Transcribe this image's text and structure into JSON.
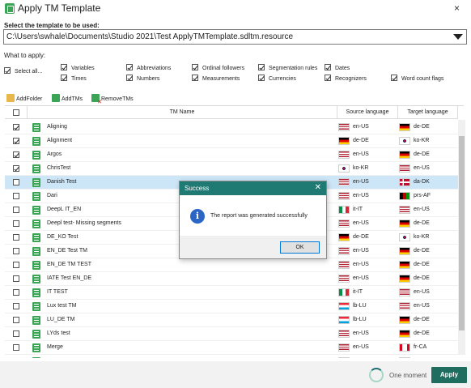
{
  "window": {
    "title": "Apply TM Template",
    "close_glyph": "×"
  },
  "template": {
    "label": "Select the template to be used:",
    "value": "C:\\Users\\swhale\\Documents\\Studio 2021\\Test ApplyTMTemplate.sdltm.resource"
  },
  "apply": {
    "label": "What to apply:",
    "options": [
      {
        "label": "Select all...",
        "checked": true
      },
      {
        "label": "Variables",
        "checked": true
      },
      {
        "label": "Times",
        "checked": true
      },
      {
        "label": "Abbreviations",
        "checked": true
      },
      {
        "label": "Numbers",
        "checked": true
      },
      {
        "label": "Ordinal followers",
        "checked": true
      },
      {
        "label": "Measurements",
        "checked": true
      },
      {
        "label": "Segmentation rules",
        "checked": true
      },
      {
        "label": "Currencies",
        "checked": true
      },
      {
        "label": "Dates",
        "checked": true
      },
      {
        "label": "Recognizers",
        "checked": true
      },
      {
        "label": "Word count flags",
        "checked": true
      }
    ]
  },
  "toolbar": {
    "add_folder": "AddFolder",
    "add_tms": "AddTMs",
    "remove_tms": "RemoveTMs"
  },
  "grid": {
    "columns": {
      "name": "TM Name",
      "source": "Source language",
      "target": "Target language"
    },
    "rows": [
      {
        "checked": true,
        "selected": false,
        "name": "Aligning",
        "src": "en-US",
        "src_flag": "us",
        "tgt": "de-DE",
        "tgt_flag": "de"
      },
      {
        "checked": true,
        "selected": false,
        "name": "Alignment",
        "src": "de-DE",
        "src_flag": "de",
        "tgt": "ko-KR",
        "tgt_flag": "kr"
      },
      {
        "checked": true,
        "selected": false,
        "name": "Argos",
        "src": "en-US",
        "src_flag": "us",
        "tgt": "de-DE",
        "tgt_flag": "de"
      },
      {
        "checked": true,
        "selected": false,
        "name": "ChrisTest",
        "src": "ko-KR",
        "src_flag": "kr",
        "tgt": "en-US",
        "tgt_flag": "us"
      },
      {
        "checked": false,
        "selected": true,
        "name": "Danish Test",
        "src": "en-US",
        "src_flag": "us",
        "tgt": "da-DK",
        "tgt_flag": "dk"
      },
      {
        "checked": false,
        "selected": false,
        "name": "Dari",
        "src": "en-US",
        "src_flag": "us",
        "tgt": "prs-AF",
        "tgt_flag": "af"
      },
      {
        "checked": false,
        "selected": false,
        "name": "DeepL IT_EN",
        "src": "it-IT",
        "src_flag": "it",
        "tgt": "en-US",
        "tgt_flag": "us"
      },
      {
        "checked": false,
        "selected": false,
        "name": "Deepl test- Missing segments",
        "src": "en-US",
        "src_flag": "us",
        "tgt": "de-DE",
        "tgt_flag": "de"
      },
      {
        "checked": false,
        "selected": false,
        "name": "DE_KO Test",
        "src": "de-DE",
        "src_flag": "de",
        "tgt": "ko-KR",
        "tgt_flag": "kr"
      },
      {
        "checked": false,
        "selected": false,
        "name": "EN_DE Test TM",
        "src": "en-US",
        "src_flag": "us",
        "tgt": "de-DE",
        "tgt_flag": "de"
      },
      {
        "checked": false,
        "selected": false,
        "name": "EN_DE TM TEST",
        "src": "en-US",
        "src_flag": "us",
        "tgt": "de-DE",
        "tgt_flag": "de"
      },
      {
        "checked": false,
        "selected": false,
        "name": "IATE Test EN_DE",
        "src": "en-US",
        "src_flag": "us",
        "tgt": "de-DE",
        "tgt_flag": "de"
      },
      {
        "checked": false,
        "selected": false,
        "name": "IT TEST",
        "src": "it-IT",
        "src_flag": "it",
        "tgt": "en-US",
        "tgt_flag": "us"
      },
      {
        "checked": false,
        "selected": false,
        "name": "Lux test TM",
        "src": "lb-LU",
        "src_flag": "lu",
        "tgt": "en-US",
        "tgt_flag": "us"
      },
      {
        "checked": false,
        "selected": false,
        "name": "LU_DE TM",
        "src": "lb-LU",
        "src_flag": "lu",
        "tgt": "de-DE",
        "tgt_flag": "de"
      },
      {
        "checked": false,
        "selected": false,
        "name": "LYds test",
        "src": "en-US",
        "src_flag": "us",
        "tgt": "de-DE",
        "tgt_flag": "de"
      },
      {
        "checked": false,
        "selected": false,
        "name": "Merge",
        "src": "en-US",
        "src_flag": "us",
        "tgt": "fr-CA",
        "tgt_flag": "ca"
      },
      {
        "checked": false,
        "selected": false,
        "name": "",
        "src": "",
        "src_flag": "us",
        "tgt": "",
        "tgt_flag": "de"
      }
    ]
  },
  "status": {
    "message": "One moment",
    "apply_label": "Apply"
  },
  "dialog": {
    "title": "Success",
    "close_glyph": "✕",
    "icon": "info-icon",
    "icon_glyph": "i",
    "message": "The report was generated successfully",
    "ok_label": "OK"
  },
  "colors": {
    "accent": "#1f6d5f",
    "dialog_header": "#1e7a73",
    "selection": "#cde6f7",
    "tm_icon": "#3aa655"
  }
}
